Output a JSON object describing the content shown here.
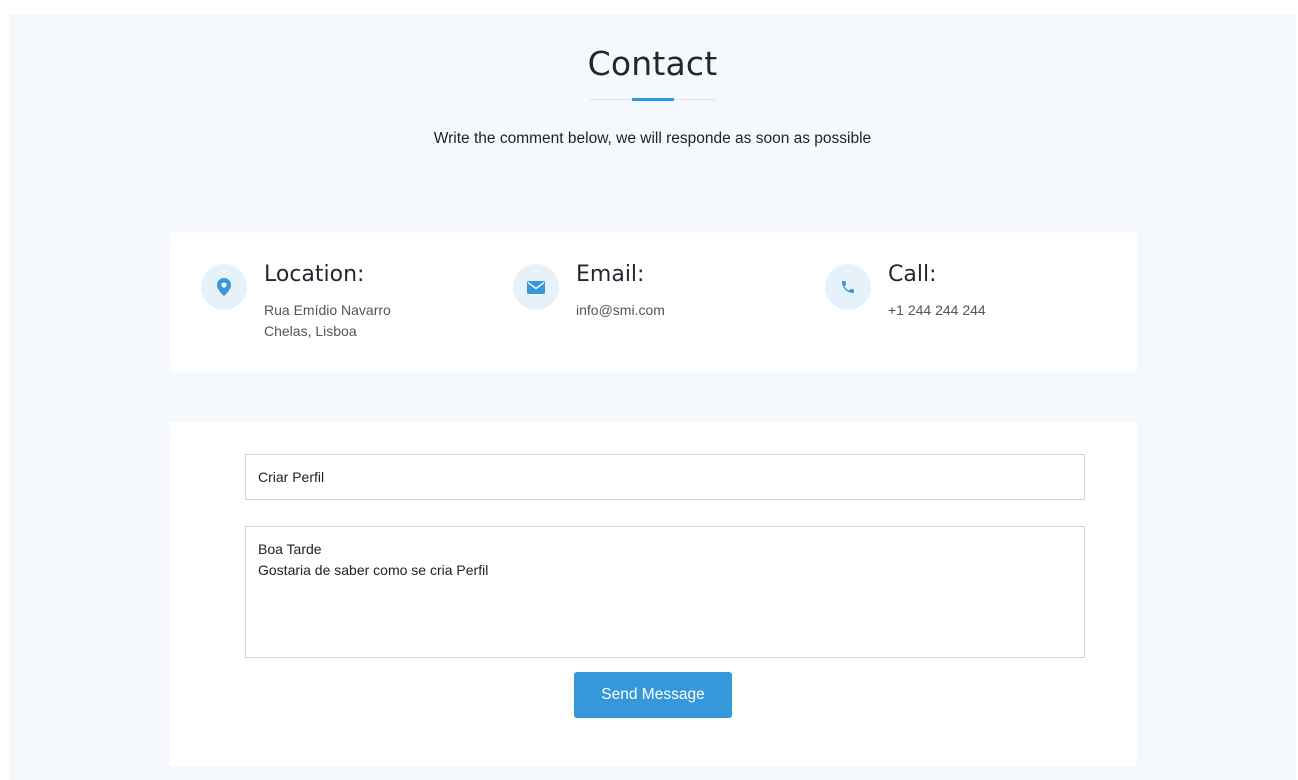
{
  "header": {
    "title": "Contact",
    "subtitle": "Write the comment below, we will responde as soon as possible"
  },
  "info": {
    "location": {
      "icon": "map-pin-icon",
      "title": "Location:",
      "line1": "Rua Emídio Navarro",
      "line2": "Chelas, Lisboa"
    },
    "email": {
      "icon": "envelope-icon",
      "title": "Email:",
      "text": "info@smi.com"
    },
    "call": {
      "icon": "phone-icon",
      "title": "Call:",
      "text": "+1 244 244 244"
    }
  },
  "form": {
    "subject_value": "Criar Perfil",
    "message_value": "Boa Tarde\nGostaria de saber como se cria Perfil",
    "send_label": "Send Message"
  },
  "colors": {
    "accent": "#3498db",
    "icon_bg": "#e7f1fa",
    "section_bg": "#f5f9fd"
  }
}
